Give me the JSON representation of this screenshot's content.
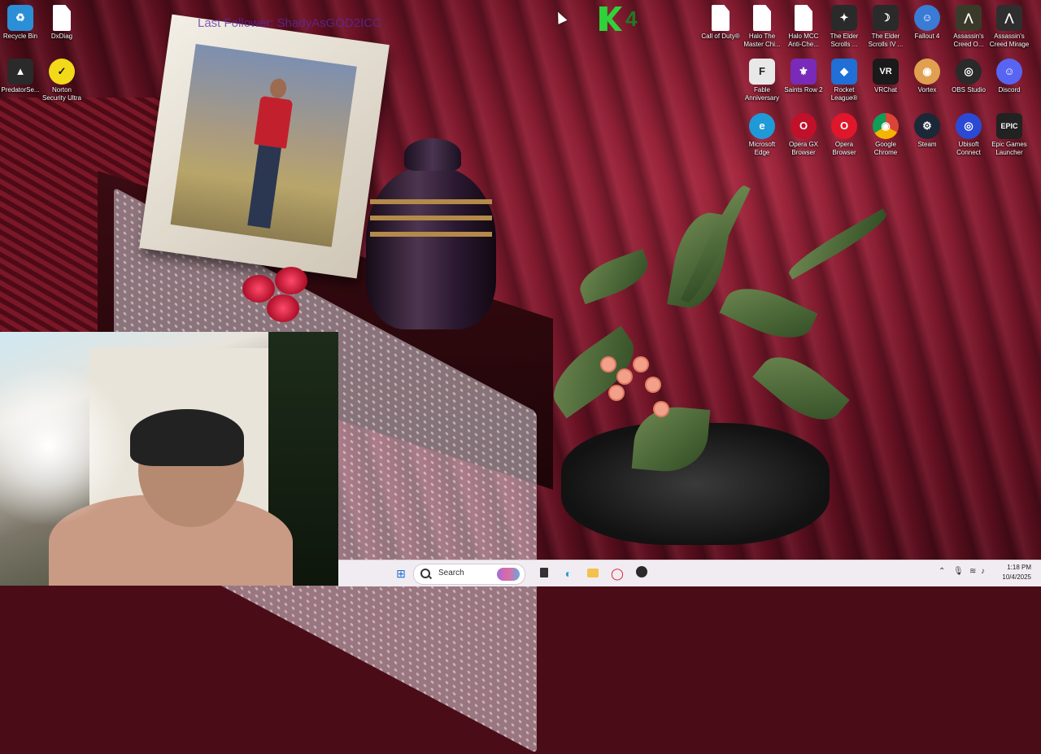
{
  "overlay": {
    "last_follower": "Last Follower: ShadyAsGOD2ICC"
  },
  "logo": {
    "number": "4"
  },
  "desktop_icons": [
    {
      "label": "Recycle Bin",
      "icon": "recycle-bin-icon",
      "color": "#2a8fd6",
      "glyph": "♻"
    },
    {
      "label": "DxDiag",
      "icon": "document-icon",
      "color": "#ffffff",
      "glyph": ""
    },
    {
      "label": "PredatorSe...",
      "icon": "predator-icon",
      "color": "#2a2a2a",
      "glyph": "▲"
    },
    {
      "label": "Norton Security Ultra",
      "icon": "norton-icon",
      "color": "#f2d91a",
      "glyph": "✓"
    },
    {
      "label": "Call of Duty®",
      "icon": "document-icon",
      "color": "#ffffff",
      "glyph": ""
    },
    {
      "label": "Halo The Master Chi...",
      "icon": "document-icon",
      "color": "#ffffff",
      "glyph": ""
    },
    {
      "label": "Halo MCC Anti-Che...",
      "icon": "document-icon",
      "color": "#ffffff",
      "glyph": ""
    },
    {
      "label": "The Elder Scrolls ...",
      "icon": "elder-scrolls-icon",
      "color": "#2a2a2a",
      "glyph": "✦"
    },
    {
      "label": "The Elder Scrolls IV ...",
      "icon": "elder-scrolls-oblivion-icon",
      "color": "#2a2a2a",
      "glyph": "☽"
    },
    {
      "label": "Fallout 4",
      "icon": "fallout-icon",
      "color": "#3a7bd5",
      "glyph": "☺"
    },
    {
      "label": "Assassin's Creed O...",
      "icon": "assassins-creed-icon",
      "color": "#3a3a2a",
      "glyph": "⋀"
    },
    {
      "label": "Assassin's Creed Mirage",
      "icon": "assassins-creed-icon",
      "color": "#2e2e2e",
      "glyph": "⋀"
    },
    {
      "label": "Fable Anniversary",
      "icon": "fable-icon",
      "color": "#e8e8e8",
      "glyph": "F"
    },
    {
      "label": "Saints Row 2",
      "icon": "saints-row-icon",
      "color": "#7a2ab8",
      "glyph": "⚜"
    },
    {
      "label": "Rocket League®",
      "icon": "rocket-league-icon",
      "color": "#1f6fd6",
      "glyph": "◆"
    },
    {
      "label": "VRChat",
      "icon": "vrchat-icon",
      "color": "#1a1a1a",
      "glyph": "VR"
    },
    {
      "label": "Vortex",
      "icon": "vortex-icon",
      "color": "#e0a050",
      "glyph": "◉"
    },
    {
      "label": "OBS Studio",
      "icon": "obs-icon",
      "color": "#2a2a2a",
      "glyph": "◎"
    },
    {
      "label": "Discord",
      "icon": "discord-icon",
      "color": "#5865f2",
      "glyph": "☺"
    },
    {
      "label": "Microsoft Edge",
      "icon": "edge-icon",
      "color": "#1f9ad6",
      "glyph": "e"
    },
    {
      "label": "Opera GX Browser",
      "icon": "opera-gx-icon",
      "color": "#c0102a",
      "glyph": "O"
    },
    {
      "label": "Opera Browser",
      "icon": "opera-icon",
      "color": "#e0162b",
      "glyph": "O"
    },
    {
      "label": "Google Chrome",
      "icon": "chrome-icon",
      "color": "#2a9a4a",
      "glyph": "◉"
    },
    {
      "label": "Steam",
      "icon": "steam-icon",
      "color": "#1b2838",
      "glyph": "⚙"
    },
    {
      "label": "Ubisoft Connect",
      "icon": "ubisoft-icon",
      "color": "#2a4ad6",
      "glyph": "◎"
    },
    {
      "label": "Epic Games Launcher",
      "icon": "epic-games-icon",
      "color": "#222222",
      "glyph": "EPIC"
    }
  ],
  "taskbar": {
    "search_placeholder": "Search",
    "time": "1:18 PM",
    "date": "10/4/2025"
  }
}
